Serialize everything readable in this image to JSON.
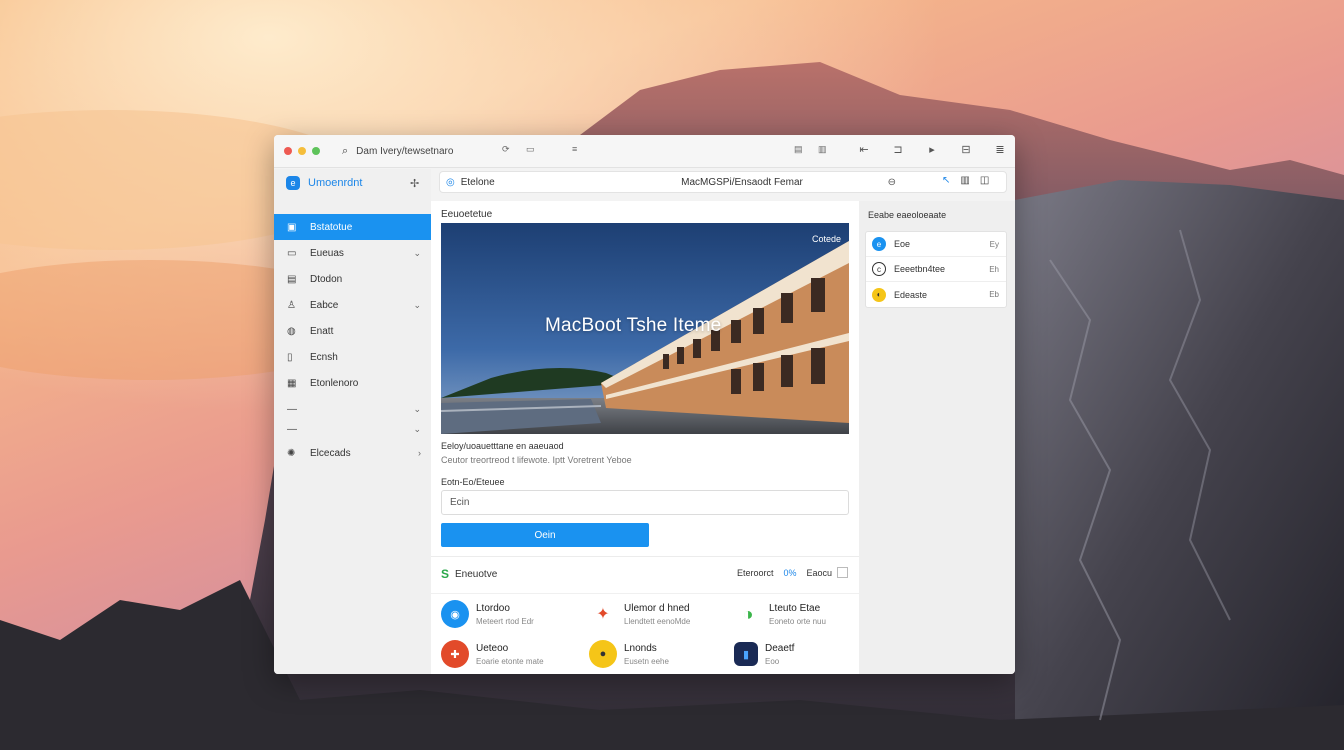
{
  "titlebar": {
    "search_text": "Dam Ivery/tewsetnaro",
    "mini_label": "≡",
    "right_icons": [
      "rewind-icon",
      "grid-icon",
      "play-icon",
      "bookmark-icon",
      "list-icon"
    ]
  },
  "sidebar": {
    "app_name": "Umoenrdnt",
    "items": [
      {
        "label": "Bstatotue",
        "icon": "photo-icon",
        "active": true
      },
      {
        "label": "Eueuas",
        "icon": "mail-icon",
        "chevron": true
      },
      {
        "label": "Dtodon",
        "icon": "trash-icon"
      },
      {
        "label": "Eabce",
        "icon": "user-icon",
        "chevron": true
      },
      {
        "label": "Enatt",
        "icon": "globe-icon"
      },
      {
        "label": "Ecnsh",
        "icon": "book-icon"
      },
      {
        "label": "Etonlenoro",
        "icon": "image-icon"
      },
      {
        "label": "—",
        "icon": "",
        "chevron": true
      },
      {
        "label": "—",
        "icon": "",
        "chevron": true
      },
      {
        "label": "Elcecads",
        "icon": "gear-icon",
        "chevron": true
      }
    ]
  },
  "addressbar": {
    "prefix": "Etelone",
    "title": "MacMGSPi/Ensaodt Femar",
    "right_icons": [
      "cursor-icon",
      "grid-icon",
      "sidebar-icon"
    ]
  },
  "main": {
    "section_title": "Eeuoetetue",
    "hero_text": "MacBoot Tshe Iteme",
    "hero_badge": "Cotede",
    "caption": "Eeloy/uoauetttane en aaeuaod",
    "caption2": "Ceutor treortreod t lifewote. Iptt Voretrent Yeboe",
    "field_label": "Eotn-Eo/Eteuee",
    "field_value": "Ecin",
    "submit_label": "Oein",
    "features_label": "Eneuotve",
    "features_meta": "Eteroorct",
    "features_meta_count": "0%",
    "features_meta_more": "Eaocu",
    "apps": [
      {
        "name": "Ltordoo",
        "sub": "Meteert rtod Edr",
        "color": "#1a92f0",
        "glyph": "◉"
      },
      {
        "name": "Ulemor d hned",
        "sub": "Llendtett eenoMde",
        "color": "#ffffff",
        "glyph": "✦"
      },
      {
        "name": "Lteuto Etae",
        "sub": "Eoneto orte nuu",
        "color": "#ffffff",
        "glyph": "◑"
      },
      {
        "name": "Ueteoo",
        "sub": "Eoarie etonte mate",
        "color": "#e24a2a",
        "glyph": "✚"
      },
      {
        "name": "Lnonds",
        "sub": "Eusetn eehe",
        "color": "#f5c518",
        "glyph": "●"
      },
      {
        "name": "Deaetf",
        "sub": "Eoo",
        "color": "#1a2a55",
        "glyph": "▮"
      }
    ]
  },
  "rpanel": {
    "title": "Eeabe eaeoloeaate",
    "items": [
      {
        "label": "Eoe",
        "tag": "Ey",
        "color": "#1a92f0"
      },
      {
        "label": "Eeeetbn4tee",
        "tag": "Eh",
        "color": "#ffffff"
      },
      {
        "label": "Edeaste",
        "tag": "Eb",
        "color": "#f5c518"
      }
    ]
  }
}
